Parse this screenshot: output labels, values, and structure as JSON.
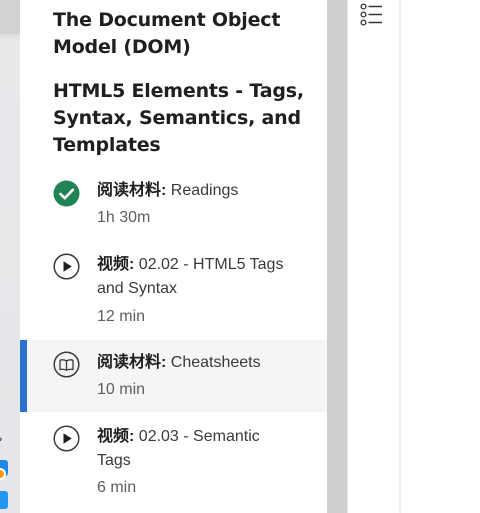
{
  "module_titles": [
    "The Document Object Model (DOM)",
    "HTML5 Elements - Tags, Syntax, Semantics, and Templates"
  ],
  "items": [
    {
      "kind": "阅读材料:",
      "title": " Readings",
      "meta": "1h 30m",
      "icon": "completed-check-icon",
      "status": "completed"
    },
    {
      "kind": "视频:",
      "title": " 02.02 - HTML5 Tags and Syntax",
      "meta": "12 min",
      "icon": "play-circle-icon",
      "status": "not-started"
    },
    {
      "kind": "阅读材料:",
      "title": " Cheatsheets",
      "meta": "10 min",
      "icon": "book-icon",
      "status": "current"
    },
    {
      "kind": "视频:",
      "title": " 02.03 - Semantic Tags",
      "meta": "6 min",
      "icon": "play-circle-icon",
      "status": "not-started"
    }
  ],
  "colors": {
    "accent": "#2a73cc",
    "completed": "#1f8354",
    "active_background": "#f5f5f5"
  },
  "toolbar": {
    "icon": "table-of-contents-icon"
  }
}
